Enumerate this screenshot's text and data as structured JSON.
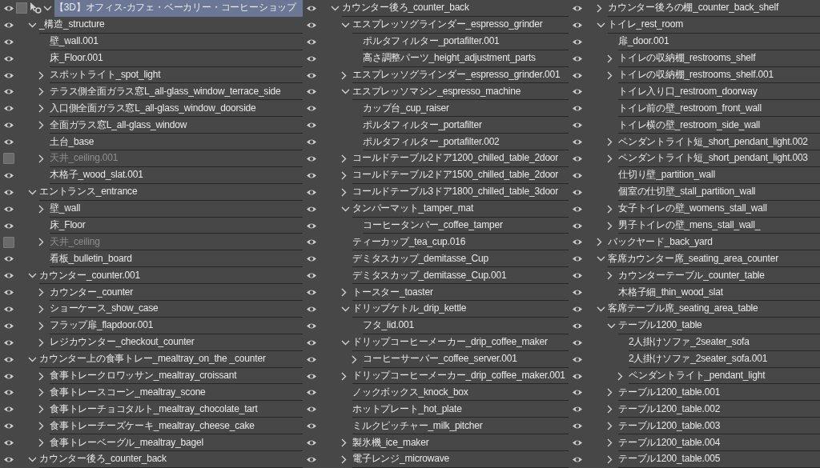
{
  "columns": [
    {
      "items": [
        {
          "label": "【3D】オフィス-カフェ・ベーカリー・コーヒーショップ",
          "visible": true,
          "checked": false,
          "selected": true,
          "expanded": true,
          "children": [
            {
              "label": "_構造_structure",
              "visible": true,
              "selected": false,
              "expanded": true,
              "children": [
                {
                  "label": "壁_wall.001",
                  "visible": true,
                  "selected": false
                },
                {
                  "label": "床_Floor.001",
                  "visible": true,
                  "selected": false
                },
                {
                  "label": "スポットライト_spot_light",
                  "visible": true,
                  "selected": false,
                  "expanded": false
                },
                {
                  "label": "テラス側全面ガラス窓L_all-glass_window_terrace_side",
                  "visible": true,
                  "selected": false,
                  "expanded": false
                },
                {
                  "label": "入口側全面ガラス窓L_all-glass_window_doorside",
                  "visible": true,
                  "selected": false,
                  "expanded": false
                },
                {
                  "label": "全面ガラス窓L_all-glass_window",
                  "visible": true,
                  "selected": false,
                  "expanded": false
                },
                {
                  "label": "土台_base",
                  "visible": true,
                  "selected": false
                },
                {
                  "label": "天井_ceiling.001",
                  "visible": false,
                  "selected": false,
                  "expanded": false
                },
                {
                  "label": "木格子_wood_slat.001",
                  "visible": true,
                  "selected": false
                }
              ]
            },
            {
              "label": "エントランス_entrance",
              "visible": true,
              "selected": false,
              "expanded": true,
              "children": [
                {
                  "label": "壁_wall",
                  "visible": true,
                  "selected": false,
                  "expanded": false
                },
                {
                  "label": "床_Floor",
                  "visible": true,
                  "selected": false
                },
                {
                  "label": "天井_ceiling",
                  "visible": false,
                  "selected": false,
                  "expanded": false
                },
                {
                  "label": "看板_bulletin_board",
                  "visible": true,
                  "selected": false
                }
              ]
            },
            {
              "label": "カウンター_counter.001",
              "visible": true,
              "selected": false,
              "expanded": true,
              "children": [
                {
                  "label": "カウンター_counter",
                  "visible": true,
                  "selected": false,
                  "expanded": false
                },
                {
                  "label": "ショーケース_show_case",
                  "visible": true,
                  "selected": false,
                  "expanded": false
                },
                {
                  "label": "フラップ扉_flapdoor.001",
                  "visible": true,
                  "selected": false,
                  "expanded": false
                },
                {
                  "label": "レジカウンター_checkout_counter",
                  "visible": true,
                  "selected": false,
                  "expanded": false
                }
              ]
            },
            {
              "label": "カウンター上の食事トレー_mealtray_on_the _counter",
              "visible": true,
              "selected": false,
              "expanded": true,
              "children": [
                {
                  "label": "食事トレークロワッサン_mealtray_croissant",
                  "visible": true,
                  "selected": false,
                  "expanded": false
                },
                {
                  "label": "食事トレースコーン_mealtray_scone",
                  "visible": true,
                  "selected": false,
                  "expanded": false
                },
                {
                  "label": "食事トレーチョコタルト_mealtray_chocolate_tart",
                  "visible": true,
                  "selected": false,
                  "expanded": false
                },
                {
                  "label": "食事トレーチーズケーキ_mealtray_cheese_cake",
                  "visible": true,
                  "selected": false,
                  "expanded": false
                },
                {
                  "label": "食事トレーベーグル_mealtray_bagel",
                  "visible": true,
                  "selected": false,
                  "expanded": false
                }
              ]
            },
            {
              "label": "カウンター後ろ_counter_back",
              "visible": true,
              "selected": false,
              "expanded": true
            }
          ]
        }
      ]
    },
    {
      "items": [
        {
          "label": "カウンター後ろ_counter_back",
          "visible": true,
          "selected": false,
          "expanded": true,
          "children": [
            {
              "label": "エスプレッソグラインダー_espresso_grinder",
              "visible": true,
              "selected": false,
              "expanded": true,
              "children": [
                {
                  "label": "ポルタフィルター_portafilter.001",
                  "visible": true,
                  "selected": false
                },
                {
                  "label": "高さ調整パーツ_height_adjustment_parts",
                  "visible": true,
                  "selected": false
                }
              ]
            },
            {
              "label": "エスプレッソグラインダー_espresso_grinder.001",
              "visible": true,
              "selected": false,
              "expanded": false
            },
            {
              "label": "エスプレッソマシン_espresso_machine",
              "visible": true,
              "selected": false,
              "expanded": true,
              "children": [
                {
                  "label": "カップ台_cup_raiser",
                  "visible": true,
                  "selected": false
                },
                {
                  "label": "ポルタフィルター_portafilter",
                  "visible": true,
                  "selected": false
                },
                {
                  "label": "ポルタフィルター_portafilter.002",
                  "visible": true,
                  "selected": false
                }
              ]
            },
            {
              "label": "コールドテーブル2ドア1200_chilled_table_2door",
              "visible": true,
              "selected": false,
              "expanded": false
            },
            {
              "label": "コールドテーブル2ドア1500_chilled_table_2door",
              "visible": true,
              "selected": false,
              "expanded": false
            },
            {
              "label": "コールドテーブル3ドア1800_chilled_table_3door",
              "visible": true,
              "selected": false,
              "expanded": false
            },
            {
              "label": "タンパーマット_tamper_mat",
              "visible": true,
              "selected": false,
              "expanded": true,
              "children": [
                {
                  "label": "コーヒータンパー_coffee_tamper",
                  "visible": true,
                  "selected": false
                }
              ]
            },
            {
              "label": "ティーカップ_tea_cup.016",
              "visible": true,
              "selected": false
            },
            {
              "label": "デミタスカップ_demitasse_Cup",
              "visible": true,
              "selected": false
            },
            {
              "label": "デミタスカップ_demitasse_Cup.001",
              "visible": true,
              "selected": false
            },
            {
              "label": "トースター_toaster",
              "visible": true,
              "selected": false,
              "expanded": false
            },
            {
              "label": "ドリップケトル_drip_kettle",
              "visible": true,
              "selected": false,
              "expanded": true,
              "children": [
                {
                  "label": "フタ_lid.001",
                  "visible": true,
                  "selected": false
                }
              ]
            },
            {
              "label": "ドリップコーヒーメーカー_drip_coffee_maker",
              "visible": true,
              "selected": false,
              "expanded": true,
              "children": [
                {
                  "label": "コーヒーサーバー_coffee_server.001",
                  "visible": true,
                  "selected": false,
                  "expanded": false
                }
              ]
            },
            {
              "label": "ドリップコーヒーメーカー_drip_coffee_maker.001",
              "visible": true,
              "selected": false,
              "expanded": false
            },
            {
              "label": "ノックボックス_knock_box",
              "visible": true,
              "selected": false
            },
            {
              "label": "ホットプレート_hot_plate",
              "visible": true,
              "selected": false
            },
            {
              "label": "ミルクピッチャー_milk_pitcher",
              "visible": true,
              "selected": false
            },
            {
              "label": "製氷機_ice_maker",
              "visible": true,
              "selected": false,
              "expanded": false
            },
            {
              "label": "電子レンジ_microwave",
              "visible": true,
              "selected": false,
              "expanded": false
            }
          ]
        }
      ]
    },
    {
      "items": [
        {
          "label": "カウンター後ろの棚_counter_back_shelf",
          "visible": true,
          "selected": false,
          "expanded": false
        },
        {
          "label": "トイレ_rest_room",
          "visible": true,
          "selected": false,
          "expanded": true,
          "children": [
            {
              "label": "扉_door.001",
              "visible": true,
              "selected": false
            },
            {
              "label": "トイレの収納棚_restrooms_shelf",
              "visible": true,
              "selected": false,
              "expanded": false
            },
            {
              "label": "トイレの収納棚_restrooms_shelf.001",
              "visible": true,
              "selected": false,
              "expanded": false
            },
            {
              "label": "トイレ入り口_restroom_doorway",
              "visible": true,
              "selected": false
            },
            {
              "label": "トイレ前の壁_restroom_front_wall",
              "visible": true,
              "selected": false
            },
            {
              "label": "トイレ横の壁_restroom_side_wall",
              "visible": true,
              "selected": false
            },
            {
              "label": "ペンダントライト短_short_pendant_light.002",
              "visible": true,
              "selected": false,
              "expanded": false
            },
            {
              "label": "ペンダントライト短_short_pendant_light.003",
              "visible": true,
              "selected": false,
              "expanded": false
            },
            {
              "label": "仕切り壁_partition_wall",
              "visible": true,
              "selected": false
            },
            {
              "label": "個室の仕切壁_stall_partition_wall",
              "visible": true,
              "selected": false
            },
            {
              "label": "女子トイレの壁_womens_stall_wall",
              "visible": true,
              "selected": false,
              "expanded": false
            },
            {
              "label": "男子トイレの壁_mens_stall_wall_",
              "visible": true,
              "selected": false,
              "expanded": false
            }
          ]
        },
        {
          "label": "バックヤード_back_yard",
          "visible": true,
          "selected": false,
          "expanded": false
        },
        {
          "label": "客席カウンター席_seating_area_counter",
          "visible": true,
          "selected": false,
          "expanded": true,
          "children": [
            {
              "label": "カウンターテーブル_counter_table",
              "visible": true,
              "selected": false,
              "expanded": false
            },
            {
              "label": "木格子細_thin_wood_slat",
              "visible": true,
              "selected": false
            }
          ]
        },
        {
          "label": "客席テーブル席_seating_area_table",
          "visible": true,
          "selected": false,
          "expanded": true,
          "children": [
            {
              "label": "テーブル1200_table",
              "visible": true,
              "selected": false,
              "expanded": true,
              "children": [
                {
                  "label": "2人掛けソファ_2seater_sofa",
                  "visible": true,
                  "selected": false
                },
                {
                  "label": "2人掛けソファ_2seater_sofa.001",
                  "visible": true,
                  "selected": false
                },
                {
                  "label": "ペンダントライト_pendant_light",
                  "visible": true,
                  "selected": false,
                  "expanded": false
                }
              ]
            },
            {
              "label": "テーブル1200_table.001",
              "visible": true,
              "selected": false,
              "expanded": false
            },
            {
              "label": "テーブル1200_table.002",
              "visible": true,
              "selected": false,
              "expanded": false
            },
            {
              "label": "テーブル1200_table.003",
              "visible": true,
              "selected": false,
              "expanded": false
            },
            {
              "label": "テーブル1200_table.004",
              "visible": true,
              "selected": false,
              "expanded": false
            },
            {
              "label": "テーブル1200_table.005",
              "visible": true,
              "selected": false,
              "expanded": false
            }
          ]
        }
      ]
    }
  ]
}
